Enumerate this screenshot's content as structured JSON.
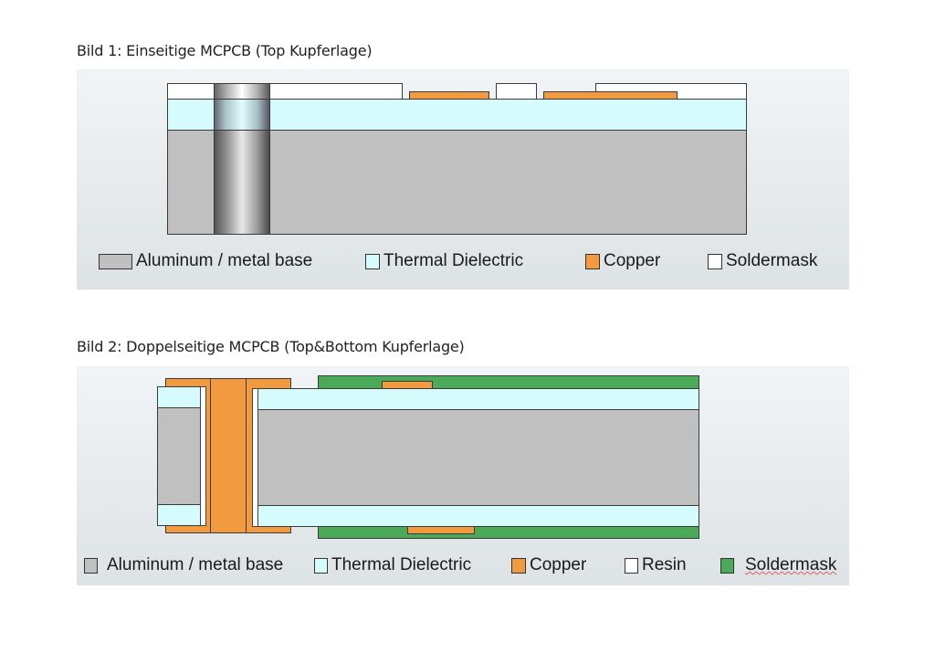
{
  "figure1": {
    "caption": "Bild 1: Einseitige MCPCB (Top Kupferlage)",
    "legend": [
      {
        "label": "Aluminum / metal base",
        "color": "#c0c0c0"
      },
      {
        "label": "Thermal Dielectric",
        "color": "#d6fbfd"
      },
      {
        "label": "Copper",
        "color": "#f29a40"
      },
      {
        "label": "Soldermask",
        "color": "#ffffff"
      }
    ]
  },
  "figure2": {
    "caption": "Bild 2: Doppelseitige MCPCB (Top&Bottom Kupferlage)",
    "legend": [
      {
        "label": "Aluminum / metal base",
        "color": "#c0c0c0"
      },
      {
        "label": "Thermal Dielectric",
        "color": "#d6fbfd"
      },
      {
        "label": "Copper",
        "color": "#f29a40"
      },
      {
        "label": "Resin",
        "color": "#ffffff"
      },
      {
        "label": "Soldermask",
        "color": "#4aaa5a"
      }
    ]
  }
}
